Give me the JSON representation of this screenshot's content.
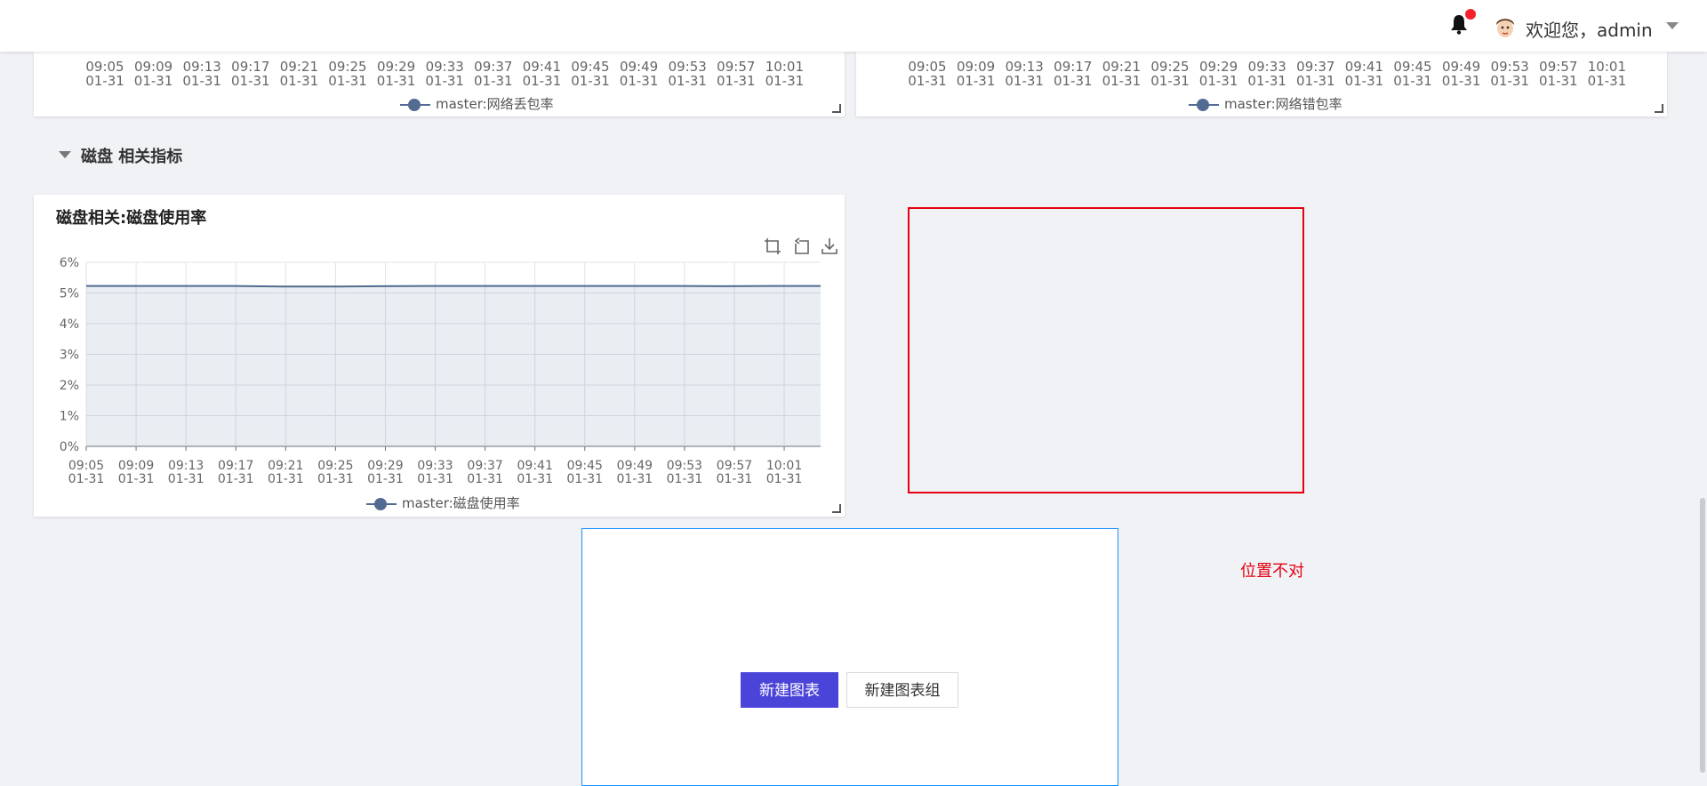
{
  "header": {
    "welcome": "欢迎您，admin",
    "notification_dot_color": "#f5222d"
  },
  "top_cards": [
    {
      "ticks": [
        [
          "09:05",
          "01-31"
        ],
        [
          "09:09",
          "01-31"
        ],
        [
          "09:13",
          "01-31"
        ],
        [
          "09:17",
          "01-31"
        ],
        [
          "09:21",
          "01-31"
        ],
        [
          "09:25",
          "01-31"
        ],
        [
          "09:29",
          "01-31"
        ],
        [
          "09:33",
          "01-31"
        ],
        [
          "09:37",
          "01-31"
        ],
        [
          "09:41",
          "01-31"
        ],
        [
          "09:45",
          "01-31"
        ],
        [
          "09:49",
          "01-31"
        ],
        [
          "09:53",
          "01-31"
        ],
        [
          "09:57",
          "01-31"
        ],
        [
          "10:01",
          "01-31"
        ]
      ],
      "legend": "master:网络丢包率"
    },
    {
      "ticks": [
        [
          "09:05",
          "01-31"
        ],
        [
          "09:09",
          "01-31"
        ],
        [
          "09:13",
          "01-31"
        ],
        [
          "09:17",
          "01-31"
        ],
        [
          "09:21",
          "01-31"
        ],
        [
          "09:25",
          "01-31"
        ],
        [
          "09:29",
          "01-31"
        ],
        [
          "09:33",
          "01-31"
        ],
        [
          "09:37",
          "01-31"
        ],
        [
          "09:41",
          "01-31"
        ],
        [
          "09:45",
          "01-31"
        ],
        [
          "09:49",
          "01-31"
        ],
        [
          "09:53",
          "01-31"
        ],
        [
          "09:57",
          "01-31"
        ],
        [
          "10:01",
          "01-31"
        ]
      ],
      "legend": "master:网络错包率"
    }
  ],
  "section": {
    "title": "磁盘 相关指标"
  },
  "disk_chart": {
    "title": "磁盘相关:磁盘使用率",
    "legend": "master:磁盘使用率",
    "tools": [
      "crop-icon",
      "restore-icon",
      "download-icon"
    ]
  },
  "chart_data": {
    "type": "area",
    "title": "磁盘相关:磁盘使用率",
    "y_unit": "%",
    "ylim": [
      0,
      6
    ],
    "y_ticks": [
      "0%",
      "1%",
      "2%",
      "3%",
      "4%",
      "5%",
      "6%"
    ],
    "x_ticks": [
      "09:05 01-31",
      "09:09 01-31",
      "09:13 01-31",
      "09:17 01-31",
      "09:21 01-31",
      "09:25 01-31",
      "09:29 01-31",
      "09:33 01-31",
      "09:37 01-31",
      "09:41 01-31",
      "09:45 01-31",
      "09:49 01-31",
      "09:53 01-31",
      "09:57 01-31",
      "10:01 01-31"
    ],
    "grid": true,
    "legend_position": "bottom",
    "series": [
      {
        "name": "master:磁盘使用率",
        "color": "#516b91",
        "values": [
          5.23,
          5.23,
          5.23,
          5.23,
          5.21,
          5.21,
          5.22,
          5.23,
          5.23,
          5.23,
          5.23,
          5.23,
          5.23,
          5.22,
          5.23,
          5.23
        ]
      }
    ]
  },
  "annotation": {
    "text": "位置不对",
    "color": "#e60012"
  },
  "new_panel": {
    "new_chart_label": "新建图表",
    "new_group_label": "新建图表组"
  }
}
